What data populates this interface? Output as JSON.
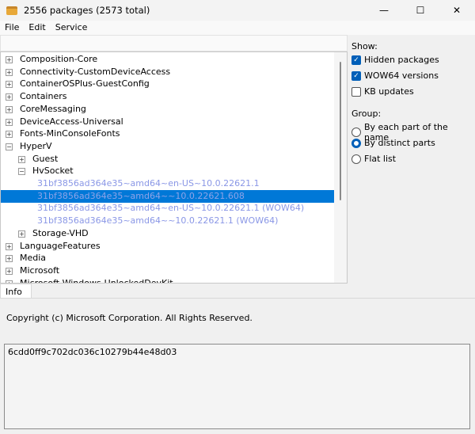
{
  "window": {
    "title": "2556 packages (2573 total)",
    "minimize": "—",
    "maximize": "☐",
    "close": "✕"
  },
  "menu": [
    "File",
    "Edit",
    "Service"
  ],
  "tree": [
    {
      "label": "Composition-Core",
      "level": 0,
      "expander": "+"
    },
    {
      "label": "Connectivity-CustomDeviceAccess",
      "level": 0,
      "expander": "+"
    },
    {
      "label": "ContainerOSPlus-GuestConfig",
      "level": 0,
      "expander": "+"
    },
    {
      "label": "Containers",
      "level": 0,
      "expander": "+"
    },
    {
      "label": "CoreMessaging",
      "level": 0,
      "expander": "+"
    },
    {
      "label": "DeviceAccess-Universal",
      "level": 0,
      "expander": "+"
    },
    {
      "label": "Fonts-MinConsoleFonts",
      "level": 0,
      "expander": "+"
    },
    {
      "label": "HyperV",
      "level": 0,
      "expander": "−"
    },
    {
      "label": "Guest",
      "level": 1,
      "expander": "+"
    },
    {
      "label": "HvSocket",
      "level": 1,
      "expander": "−"
    },
    {
      "label": "31bf3856ad364e35~amd64~en-US~10.0.22621.1",
      "level": 2,
      "package": true
    },
    {
      "label": "31bf3856ad364e35~amd64~~10.0.22621.608",
      "level": 2,
      "package": true,
      "selected": true
    },
    {
      "label": "31bf3856ad364e35~amd64~en-US~10.0.22621.1 (WOW64)",
      "level": 2,
      "package": true
    },
    {
      "label": "31bf3856ad364e35~amd64~~10.0.22621.1 (WOW64)",
      "level": 2,
      "package": true
    },
    {
      "label": "Storage-VHD",
      "level": 1,
      "expander": "+"
    },
    {
      "label": "LanguageFeatures",
      "level": 0,
      "expander": "+"
    },
    {
      "label": "Media",
      "level": 0,
      "expander": "+"
    },
    {
      "label": "Microsoft",
      "level": 0,
      "expander": "+"
    },
    {
      "label": "Microsoft-Windows-UnlockedDevKit",
      "level": 0,
      "expander": "+"
    }
  ],
  "show": {
    "heading": "Show:",
    "options": [
      {
        "label": "Hidden packages",
        "checked": true
      },
      {
        "label": "WOW64 versions",
        "checked": true
      },
      {
        "label": "KB updates",
        "checked": false
      }
    ]
  },
  "group": {
    "heading": "Group:",
    "options": [
      {
        "label": "By each part of the name",
        "selected": false
      },
      {
        "label": "By distinct parts",
        "selected": true
      },
      {
        "label": "Flat list",
        "selected": false
      }
    ]
  },
  "info": {
    "tab": "Info",
    "copyright": "Copyright (c) Microsoft Corporation. All Rights Reserved.",
    "hash": "6cdd0ff9c702dc036c10279b44e48d03"
  },
  "colors": {
    "selection": "#0078d7",
    "package_text": "#8a97e6",
    "accent": "#005fb8"
  }
}
